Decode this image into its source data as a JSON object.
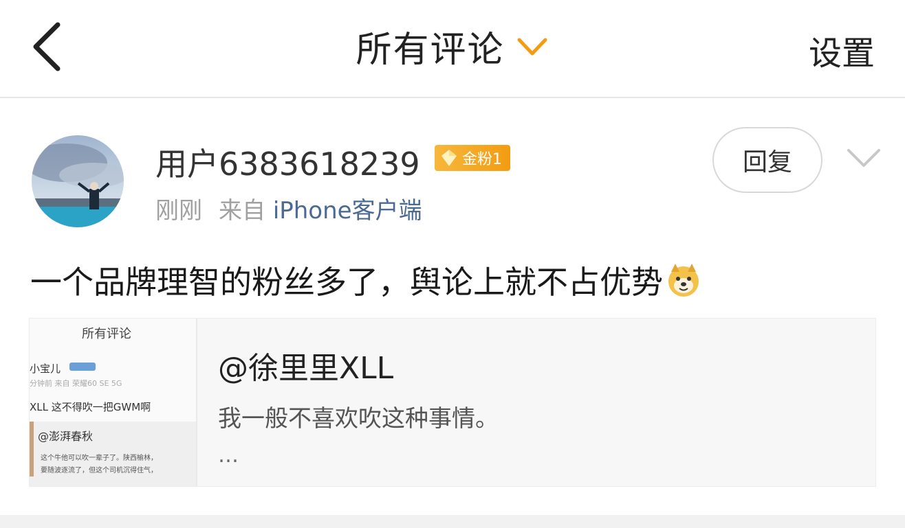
{
  "header": {
    "title": "所有评论",
    "settings_label": "设置"
  },
  "comment": {
    "username": "用户6383618239",
    "badge": "金粉1",
    "time": "刚刚",
    "source_prefix": "来自",
    "source_device": "iPhone客户端",
    "reply_label": "回复",
    "text": "一个品牌理智的粉丝多了，舆论上就不占优势",
    "emoji": "doge-emoji"
  },
  "quote": {
    "author": "@徐里里XLL",
    "text": "我一般不喜欢吹这种事情。",
    "ellipsis": "…",
    "thumbnail": {
      "title": "所有评论",
      "user": "小宝儿",
      "meta": "分钟前 来自 荣耀60 SE 5G",
      "body": "XLL 这不得吹一把GWM啊",
      "mention": "@澎湃春秋",
      "line1": "这个牛他可以吹一辈子了。陕西榆林，",
      "line2": "要随波逐流了，但这个司机沉得住气，"
    }
  },
  "colors": {
    "accent_orange": "#f39c12",
    "badge_gold": "#f6b73c",
    "link_blue": "#4a6a95",
    "muted_gray": "#a0a0a0"
  }
}
